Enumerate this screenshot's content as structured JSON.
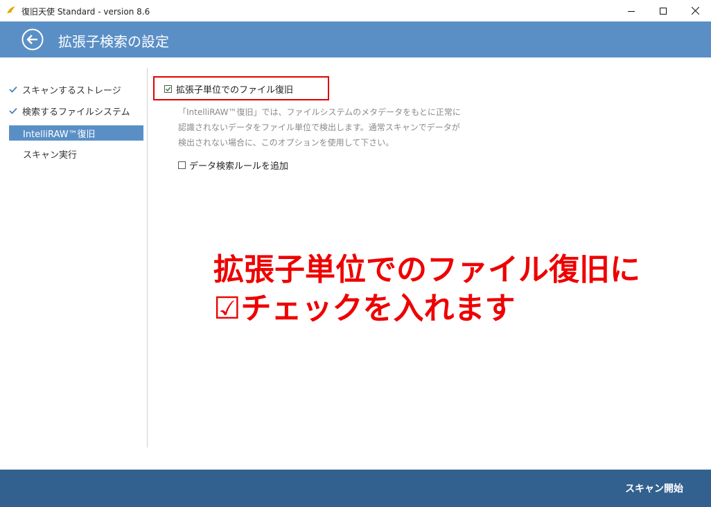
{
  "window": {
    "title": "復旧天使 Standard - version 8.6",
    "controls": {
      "minimize": "minimize",
      "maximize": "maximize",
      "close": "close"
    }
  },
  "header": {
    "back_icon": "arrow-left-circle-icon",
    "title": "拡張子検索の設定"
  },
  "sidebar": {
    "items": [
      {
        "label": "スキャンするストレージ",
        "checked": true
      },
      {
        "label": "検索するファイルシステム",
        "checked": true
      },
      {
        "label": "IntelliRAW™復旧",
        "active": true
      },
      {
        "label": "スキャン実行"
      }
    ]
  },
  "options": {
    "extension_recovery": {
      "label": "拡張子単位でのファイル復旧",
      "checked": true
    },
    "description": [
      "「IntelliRAW™復旧」では、ファイルシステムのメタデータをもとに正常に",
      "認識されないデータをファイル単位で検出します。通常スキャンでデータが",
      "検出されない場合に、このオプションを使用して下さい。"
    ],
    "add_rule": {
      "label": "データ検索ルールを追加",
      "checked": false
    }
  },
  "annotation": {
    "line1": "拡張子単位でのファイル復旧に",
    "line2": "☑チェックを入れます"
  },
  "footer": {
    "start_scan": "スキャン開始"
  },
  "colors": {
    "header": "#5a8fc6",
    "footer": "#32618f",
    "active_item": "#5a8fc6",
    "annotation": "#ee0000",
    "check": "#4a7fb5"
  }
}
